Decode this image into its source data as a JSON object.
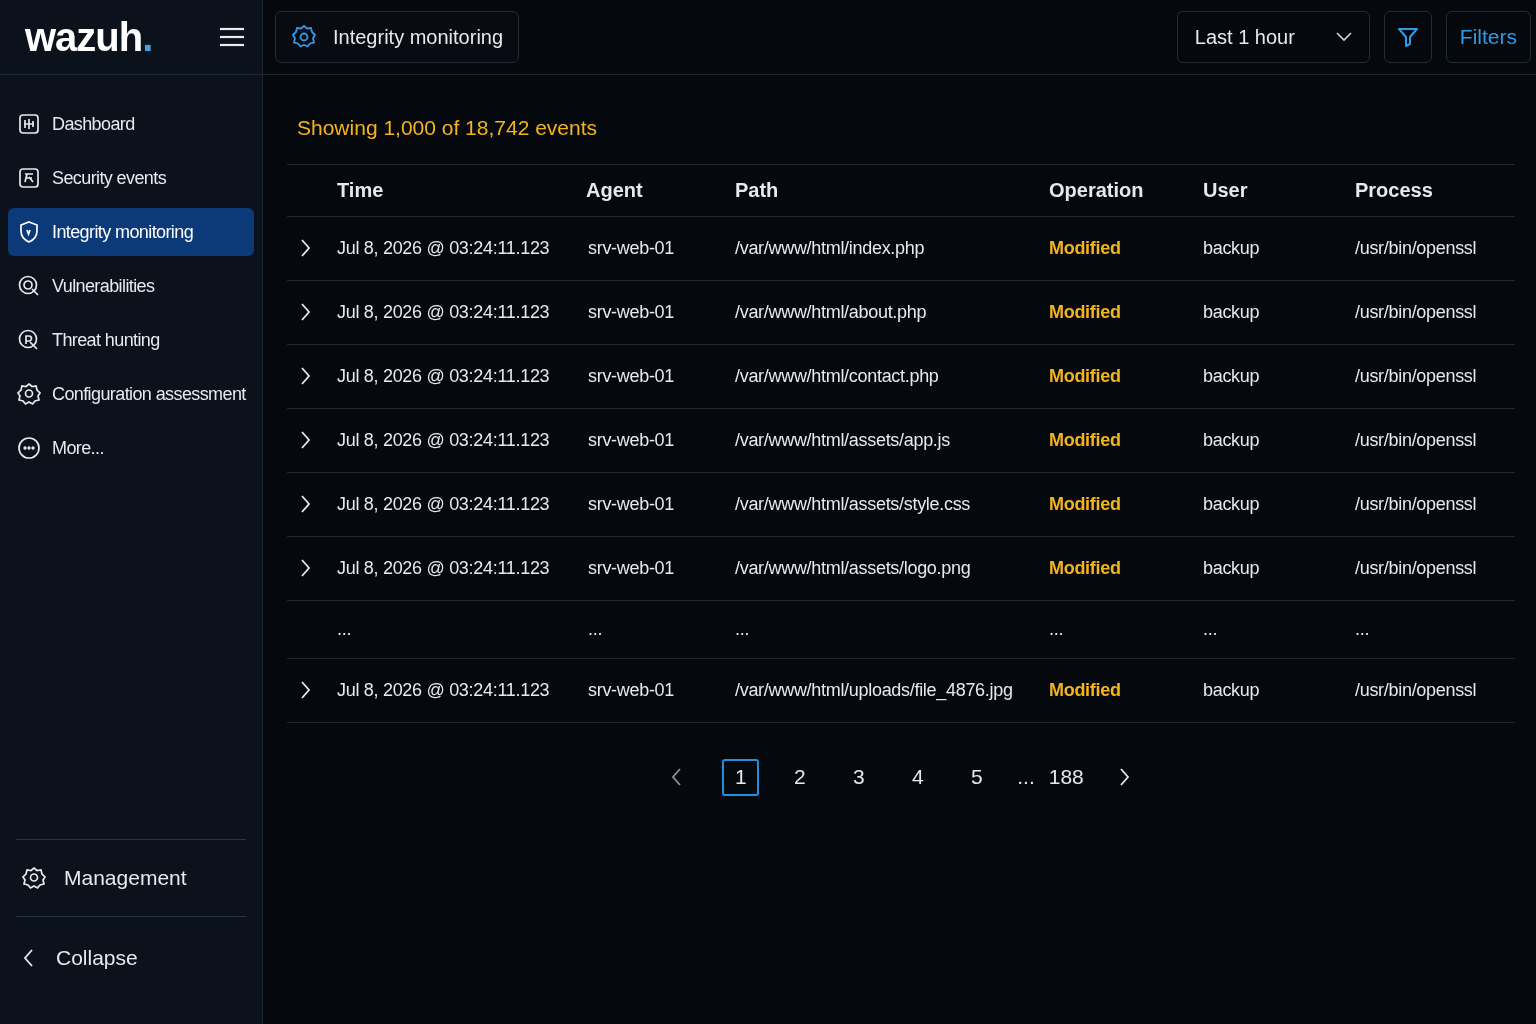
{
  "logo": {
    "text": "wazuh",
    "dot": "."
  },
  "header": {
    "module": "Integrity monitoring",
    "time_range": "Last 1 hour",
    "filters_button": "Filters"
  },
  "sidebar": {
    "items": [
      {
        "label": "Dashboard",
        "selected": false
      },
      {
        "label": "Security events",
        "selected": false
      },
      {
        "label": "Integrity monitoring",
        "selected": true
      },
      {
        "label": "Vulnerabilities",
        "selected": false
      },
      {
        "label": "Threat hunting",
        "selected": false
      },
      {
        "label": "Configuration assessment",
        "selected": false
      },
      {
        "label": "More...",
        "selected": false
      }
    ],
    "management": "Management",
    "collapse": "Collapse"
  },
  "summary": "Showing 1,000 of 18,742 events",
  "table": {
    "columns": [
      "Time",
      "Agent",
      "Path",
      "Operation",
      "User",
      "Process"
    ],
    "rows": [
      {
        "kind": "event",
        "cells": [
          "Jul 8, 2026 @ 03:24:11.123",
          "srv-web-01",
          "/var/www/html/index.php",
          "Modified",
          "backup",
          "/usr/bin/openssl"
        ]
      },
      {
        "kind": "event",
        "cells": [
          "Jul 8, 2026 @ 03:24:11.123",
          "srv-web-01",
          "/var/www/html/about.php",
          "Modified",
          "backup",
          "/usr/bin/openssl"
        ]
      },
      {
        "kind": "event",
        "cells": [
          "Jul 8, 2026 @ 03:24:11.123",
          "srv-web-01",
          "/var/www/html/contact.php",
          "Modified",
          "backup",
          "/usr/bin/openssl"
        ]
      },
      {
        "kind": "event",
        "cells": [
          "Jul 8, 2026 @ 03:24:11.123",
          "srv-web-01",
          "/var/www/html/assets/app.js",
          "Modified",
          "backup",
          "/usr/bin/openssl"
        ]
      },
      {
        "kind": "event",
        "cells": [
          "Jul 8, 2026 @ 03:24:11.123",
          "srv-web-01",
          "/var/www/html/assets/style.css",
          "Modified",
          "backup",
          "/usr/bin/openssl"
        ]
      },
      {
        "kind": "event",
        "cells": [
          "Jul 8, 2026 @ 03:24:11.123",
          "srv-web-01",
          "/var/www/html/assets/logo.png",
          "Modified",
          "backup",
          "/usr/bin/openssl"
        ]
      },
      {
        "kind": "gap",
        "cells": [
          "...",
          "...",
          "...",
          "...",
          "...",
          "..."
        ]
      },
      {
        "kind": "event",
        "cells": [
          "Jul 8, 2026 @ 03:24:11.123",
          "srv-web-01",
          "/var/www/html/uploads/file_4876.jpg",
          "Modified",
          "backup",
          "/usr/bin/openssl"
        ]
      }
    ]
  },
  "pagination": {
    "pages": [
      {
        "label": "1",
        "selected": true
      },
      {
        "label": "2",
        "selected": false
      },
      {
        "label": "3",
        "selected": false
      },
      {
        "label": "4",
        "selected": false
      },
      {
        "label": "5",
        "selected": false
      }
    ],
    "ellipsis": "...",
    "last": "188"
  }
}
